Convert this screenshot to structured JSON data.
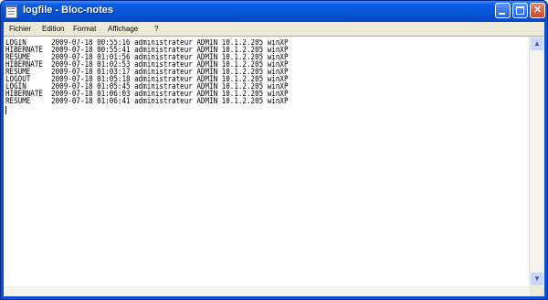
{
  "window": {
    "title": "logfile - Bloc-notes",
    "minimize_glyph": "",
    "maximize_glyph": "",
    "close_glyph": "✕"
  },
  "menu": {
    "items": [
      "Fichier",
      "Edition",
      "Format",
      "Affichage",
      "?"
    ]
  },
  "document": {
    "lines": [
      "LOGIN      2009-07-18 00:55:16 administrateur ADMIN 10.1.2.205 winXP",
      "HIBERNATE  2009-07-18 00:55:41 administrateur ADMIN 10.1.2.205 winXP",
      "RESUME     2009-07-18 01:01:56 administrateur ADMIN 10.1.2.205 winXP",
      "HIBERNATE  2009-07-18 01:02:53 administrateur ADMIN 10.1.2.205 winXP",
      "RESUME     2009-07-18 01:03:17 administrateur ADMIN 10.1.2.205 winXP",
      "LOGOUT     2009-07-18 01:05:18 administrateur ADMIN 10.1.2.205 winXP",
      "LOGIN      2009-07-18 01:05:45 administrateur ADMIN 10.1.2.205 winXP",
      "HIBERNATE  2009-07-18 01:06:03 administrateur ADMIN 10.1.2.205 winXP",
      "RESUME     2009-07-18 01:06:41 administrateur ADMIN 10.1.2.205 winXP"
    ]
  },
  "scrollbar": {
    "up_arrow": "▲",
    "down_arrow": "▼"
  },
  "colors": {
    "titlebar": "#0453d6",
    "menubar": "#ece9d8",
    "editor_background": "#ffffff",
    "close_button": "#c84a2a"
  }
}
